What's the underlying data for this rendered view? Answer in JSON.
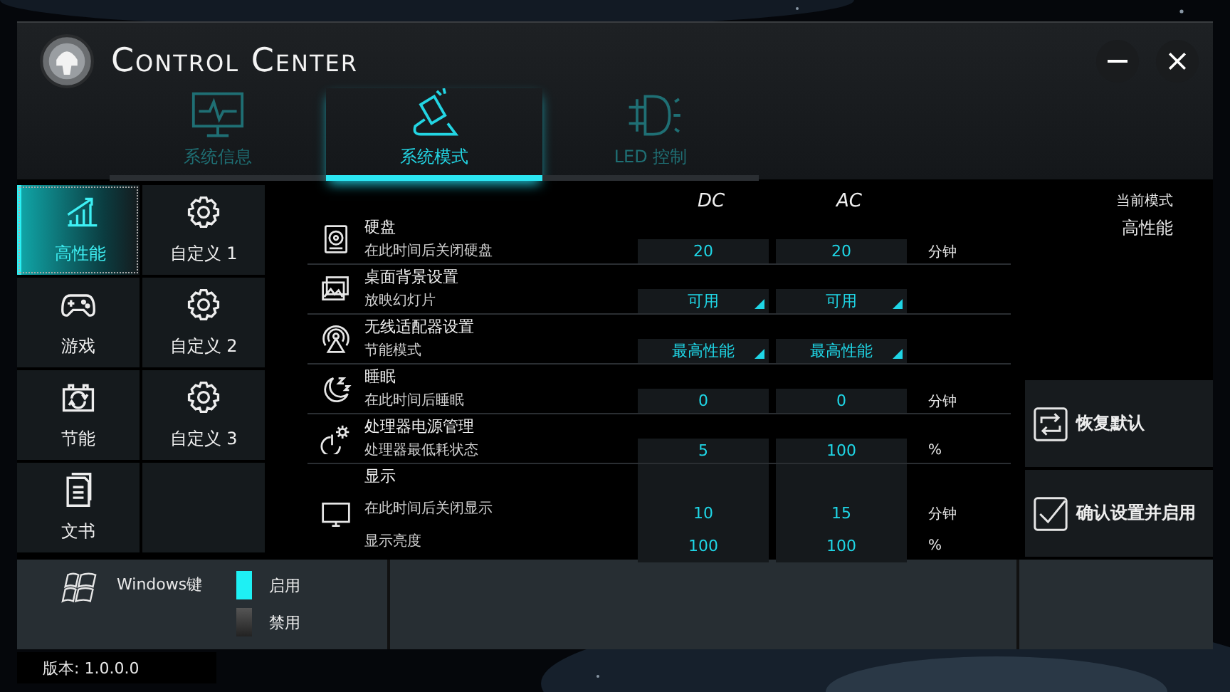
{
  "window": {
    "title": "Control Center"
  },
  "tabs": [
    {
      "label": "系统信息",
      "selected": false
    },
    {
      "label": "系统模式",
      "selected": true
    },
    {
      "label": "LED 控制",
      "selected": false
    }
  ],
  "modes": [
    {
      "label": "高性能",
      "kind": "performance",
      "selected": true
    },
    {
      "label": "自定义 1",
      "kind": "custom",
      "selected": false
    },
    {
      "label": "游戏",
      "kind": "gaming",
      "selected": false
    },
    {
      "label": "自定义 2",
      "kind": "custom",
      "selected": false
    },
    {
      "label": "节能",
      "kind": "saving",
      "selected": false
    },
    {
      "label": "自定义 3",
      "kind": "custom",
      "selected": false
    },
    {
      "label": "文书",
      "kind": "office",
      "selected": false
    }
  ],
  "columns": [
    "DC",
    "AC"
  ],
  "settings": [
    {
      "title": "硬盘",
      "kind": "number",
      "lines": [
        {
          "label": "在此时间后关闭硬盘",
          "dc": "20",
          "ac": "20",
          "unit": "分钟"
        }
      ]
    },
    {
      "title": "桌面背景设置",
      "kind": "dropdown",
      "lines": [
        {
          "label": "放映幻灯片",
          "dc": "可用",
          "ac": "可用"
        }
      ]
    },
    {
      "title": "无线适配器设置",
      "kind": "dropdown",
      "lines": [
        {
          "label": "节能模式",
          "dc": "最高性能",
          "ac": "最高性能"
        }
      ]
    },
    {
      "title": "睡眠",
      "kind": "number",
      "lines": [
        {
          "label": "在此时间后睡眠",
          "dc": "0",
          "ac": "0",
          "unit": "分钟"
        }
      ]
    },
    {
      "title": "处理器电源管理",
      "kind": "number",
      "lines": [
        {
          "label": "处理器最低耗状态",
          "dc": "5",
          "ac": "100",
          "unit": "%"
        }
      ]
    },
    {
      "title": "显示",
      "kind": "number",
      "lines": [
        {
          "label": "在此时间后关闭显示",
          "dc": "10",
          "ac": "15",
          "unit": "分钟"
        },
        {
          "label": "显示亮度",
          "dc": "100",
          "ac": "100",
          "unit": "%"
        }
      ]
    }
  ],
  "current_mode": {
    "label": "当前模式",
    "value": "高性能"
  },
  "actions": [
    {
      "label": "恢复默认",
      "kind": "restore"
    },
    {
      "label": "确认设置并启用",
      "kind": "confirm"
    }
  ],
  "windows_key": {
    "label": "Windows键",
    "options": [
      {
        "label": "启用",
        "selected": true
      },
      {
        "label": "禁用",
        "selected": false
      }
    ]
  },
  "version": "版本: 1.0.0.0"
}
